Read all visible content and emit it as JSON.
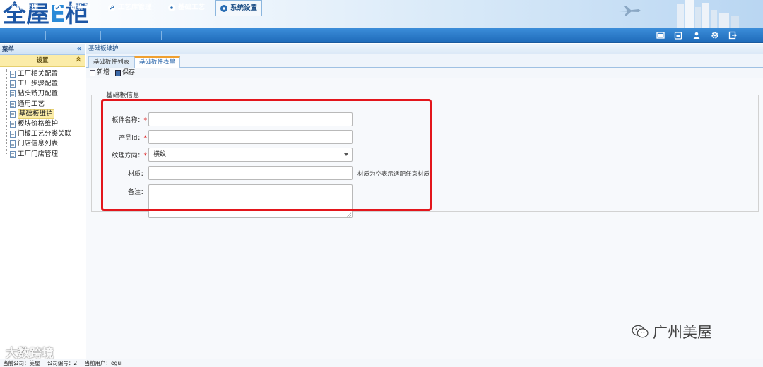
{
  "app": {
    "logo_text": "全屋",
    "logo_e": "E",
    "logo_text2": "柜"
  },
  "topnav": {
    "tabs": [
      {
        "label": "门店管理",
        "icon": "store-icon"
      },
      {
        "label": "一键拆单",
        "icon": "check-circle-icon"
      },
      {
        "label": "工艺库管理",
        "icon": "wrench-icon"
      },
      {
        "label": "基础工艺",
        "icon": "gear-circle-icon"
      },
      {
        "label": "系统设置",
        "icon": "settings-icon",
        "active": true
      }
    ],
    "tool_icons": [
      "home-screen-icon",
      "calendar-icon",
      "user-icon",
      "gear-icon",
      "logout-icon"
    ]
  },
  "sidebar": {
    "title": "菜单",
    "collapse_glyph": "«",
    "section": "设置",
    "section_glyph": "«",
    "items": [
      {
        "label": "工厂相关配置"
      },
      {
        "label": "工厂步骤配置"
      },
      {
        "label": "钻头铣刀配置"
      },
      {
        "label": "通用工艺"
      },
      {
        "label": "基础板维护",
        "active": true
      },
      {
        "label": "板块价格维护"
      },
      {
        "label": "门板工艺分类关联"
      },
      {
        "label": "门店信息列表"
      },
      {
        "label": "工厂门店管理"
      }
    ]
  },
  "main": {
    "breadcrumb": "基础板维护",
    "subtabs": [
      {
        "label": "基础板件列表"
      },
      {
        "label": "基础板件表单",
        "active": true
      }
    ],
    "toolbar": {
      "new_label": "新增",
      "save_label": "保存"
    },
    "form": {
      "legend": "基础板信息",
      "fields": {
        "name_label": "板件名称：",
        "product_id_label": "产品id：",
        "grain_label": "纹理方向：",
        "grain_value": "横纹",
        "material_label": "材质：",
        "material_hint": "材质为空表示适配任意材质",
        "remark_label": "备注："
      },
      "required_mark": "*"
    }
  },
  "statusbar": {
    "company": "当前公司：美屋",
    "company_no": "公司编号：2",
    "user": "当前用户：egui"
  },
  "watermarks": {
    "bottom_right": "广州美屋",
    "bottom_left": "大数跨境"
  },
  "colors": {
    "nav_blue": "#2a7bcb",
    "highlight_yellow": "#fbeca8",
    "annotation_red": "#e3161c"
  }
}
